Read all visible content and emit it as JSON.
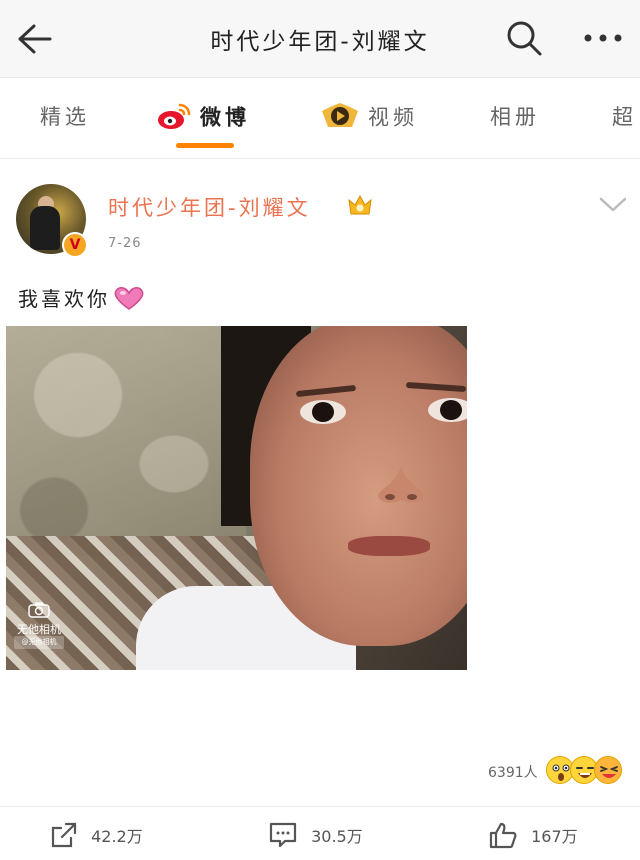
{
  "header": {
    "title": "时代少年团-刘耀文",
    "back_icon": "back-arrow-icon",
    "search_icon": "search-icon",
    "more_icon": "more-dots-icon"
  },
  "tabs": [
    {
      "label": "精选",
      "active": false
    },
    {
      "label": "微博",
      "active": true,
      "icon": "weibo-logo-icon"
    },
    {
      "label": "视频",
      "active": false,
      "icon": "video-play-icon"
    },
    {
      "label": "相册",
      "active": false
    },
    {
      "label": "超",
      "active": false
    }
  ],
  "post": {
    "author": "时代少年团-刘耀文",
    "date": "7-26",
    "text": "我喜欢你",
    "verified_badge": "V",
    "watermark": {
      "line1": "无他相机",
      "line2": "@无他相机"
    }
  },
  "reactions": {
    "count": "6391人"
  },
  "actions": {
    "repost": "42.2万",
    "comment": "30.5万",
    "like": "167万"
  },
  "colors": {
    "accent": "#ff8200",
    "username": "#eb7350",
    "badge": "#f5a623"
  }
}
